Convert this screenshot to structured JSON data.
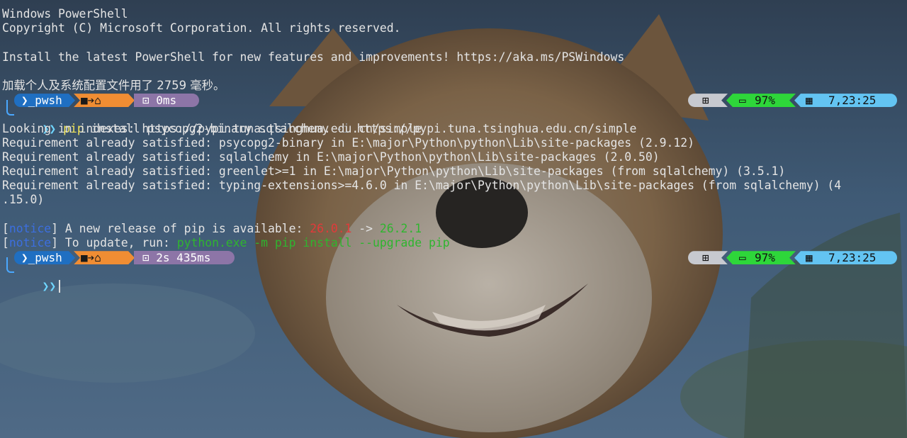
{
  "header": {
    "line1": "Windows PowerShell",
    "line2": "Copyright (C) Microsoft Corporation. All rights reserved.",
    "line3": "Install the latest PowerShell for new features and improvements! https://aka.ms/PSWindows",
    "line4": "加载个人及系统配置文件用了 2759 毫秒。"
  },
  "prompt1": {
    "shell": "pwsh",
    "time": "0ms",
    "battery": "97%",
    "clock": "7,23:25"
  },
  "command1": {
    "program": "pip",
    "args": " install psycopg2-binary sqlalchemy ",
    "flag": "-i",
    "url": " https://pypi.tuna.tsinghua.edu.cn/simple"
  },
  "output": [
    "Looking in indexes: https://pypi.tuna.tsinghua.edu.cn/simple",
    "Requirement already satisfied: psycopg2-binary in E:\\major\\Python\\python\\Lib\\site-packages (2.9.12)",
    "Requirement already satisfied: sqlalchemy in E:\\major\\Python\\python\\Lib\\site-packages (2.0.50)",
    "Requirement already satisfied: greenlet>=1 in E:\\major\\Python\\python\\Lib\\site-packages (from sqlalchemy) (3.5.1)",
    "Requirement already satisfied: typing-extensions>=4.6.0 in E:\\major\\Python\\python\\Lib\\site-packages (from sqlalchemy) (4",
    ".15.0)"
  ],
  "notice1": {
    "open": "[",
    "tag": "notice",
    "close": "]",
    "text": " A new release of pip is available: ",
    "old": "26.0.1",
    "arrow": " -> ",
    "new": "26.2.1"
  },
  "notice2": {
    "open": "[",
    "tag": "notice",
    "close": "]",
    "text": " To update, run: ",
    "cmd": "python.exe -m pip install --upgrade pip"
  },
  "prompt2": {
    "shell": "pwsh",
    "time": "2s 435ms",
    "battery": "97%",
    "clock": "7,23:25"
  },
  "colors": {
    "shell_segment": "#1f6fc2",
    "path_segment": "#f08d33",
    "time_segment": "#8d75a7",
    "os_segment": "#c7c9cf",
    "battery_segment": "#2ed63a",
    "clock_segment": "#63c4f2",
    "command": "#f2e65a",
    "notice_tag": "#3c6fe0",
    "old_version": "#e23a3a",
    "new_version": "#2fb52f"
  },
  "icons": [
    "terminal-icon",
    "folder-arrow-icon",
    "home-icon",
    "stopwatch-icon",
    "windows-icon",
    "battery-icon",
    "calendar-icon",
    "prompt-chevron-icon"
  ]
}
